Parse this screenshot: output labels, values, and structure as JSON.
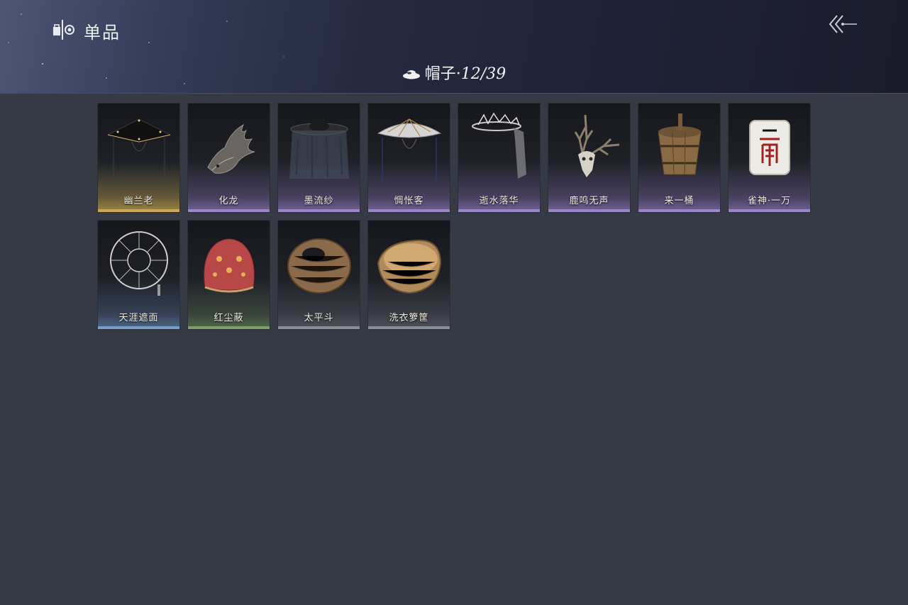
{
  "header": {
    "title": "单品",
    "icon": "wardrobe-icon",
    "back_icon": "back-arrow-icon"
  },
  "category": {
    "name": "帽子",
    "separator": "·",
    "count": "12/39",
    "icon": "hat-icon"
  },
  "items": [
    {
      "label": "幽兰老",
      "rarity": "gold",
      "icon": "black-straw-hat-icon"
    },
    {
      "label": "化龙",
      "rarity": "purple",
      "icon": "dragon-head-icon"
    },
    {
      "label": "墨流纱",
      "rarity": "purple",
      "icon": "veiled-hat-icon"
    },
    {
      "label": "惆怅客",
      "rarity": "purple",
      "icon": "white-bamboo-hat-icon"
    },
    {
      "label": "逝水落华",
      "rarity": "purple",
      "icon": "bone-crown-veil-icon"
    },
    {
      "label": "鹿鸣无声",
      "rarity": "purple",
      "icon": "deer-skull-icon"
    },
    {
      "label": "来一桶",
      "rarity": "purple",
      "icon": "wooden-bucket-icon"
    },
    {
      "label": "雀神·一万",
      "rarity": "purple",
      "icon": "mahjong-tile-icon"
    },
    {
      "label": "天涯遮面",
      "rarity": "blue",
      "icon": "broken-frame-hat-icon"
    },
    {
      "label": "红尘蔽",
      "rarity": "green",
      "icon": "red-hood-icon"
    },
    {
      "label": "太平斗",
      "rarity": "gray",
      "icon": "wicker-basket-icon"
    },
    {
      "label": "洗衣箩筐",
      "rarity": "gray",
      "icon": "laundry-basket-icon"
    }
  ],
  "colors": {
    "background": "#363a44",
    "gold": "#c9a757",
    "purple": "#9b86c8",
    "blue": "#7a9cc7",
    "green": "#7f9c6a",
    "gray": "#8a8d96"
  }
}
